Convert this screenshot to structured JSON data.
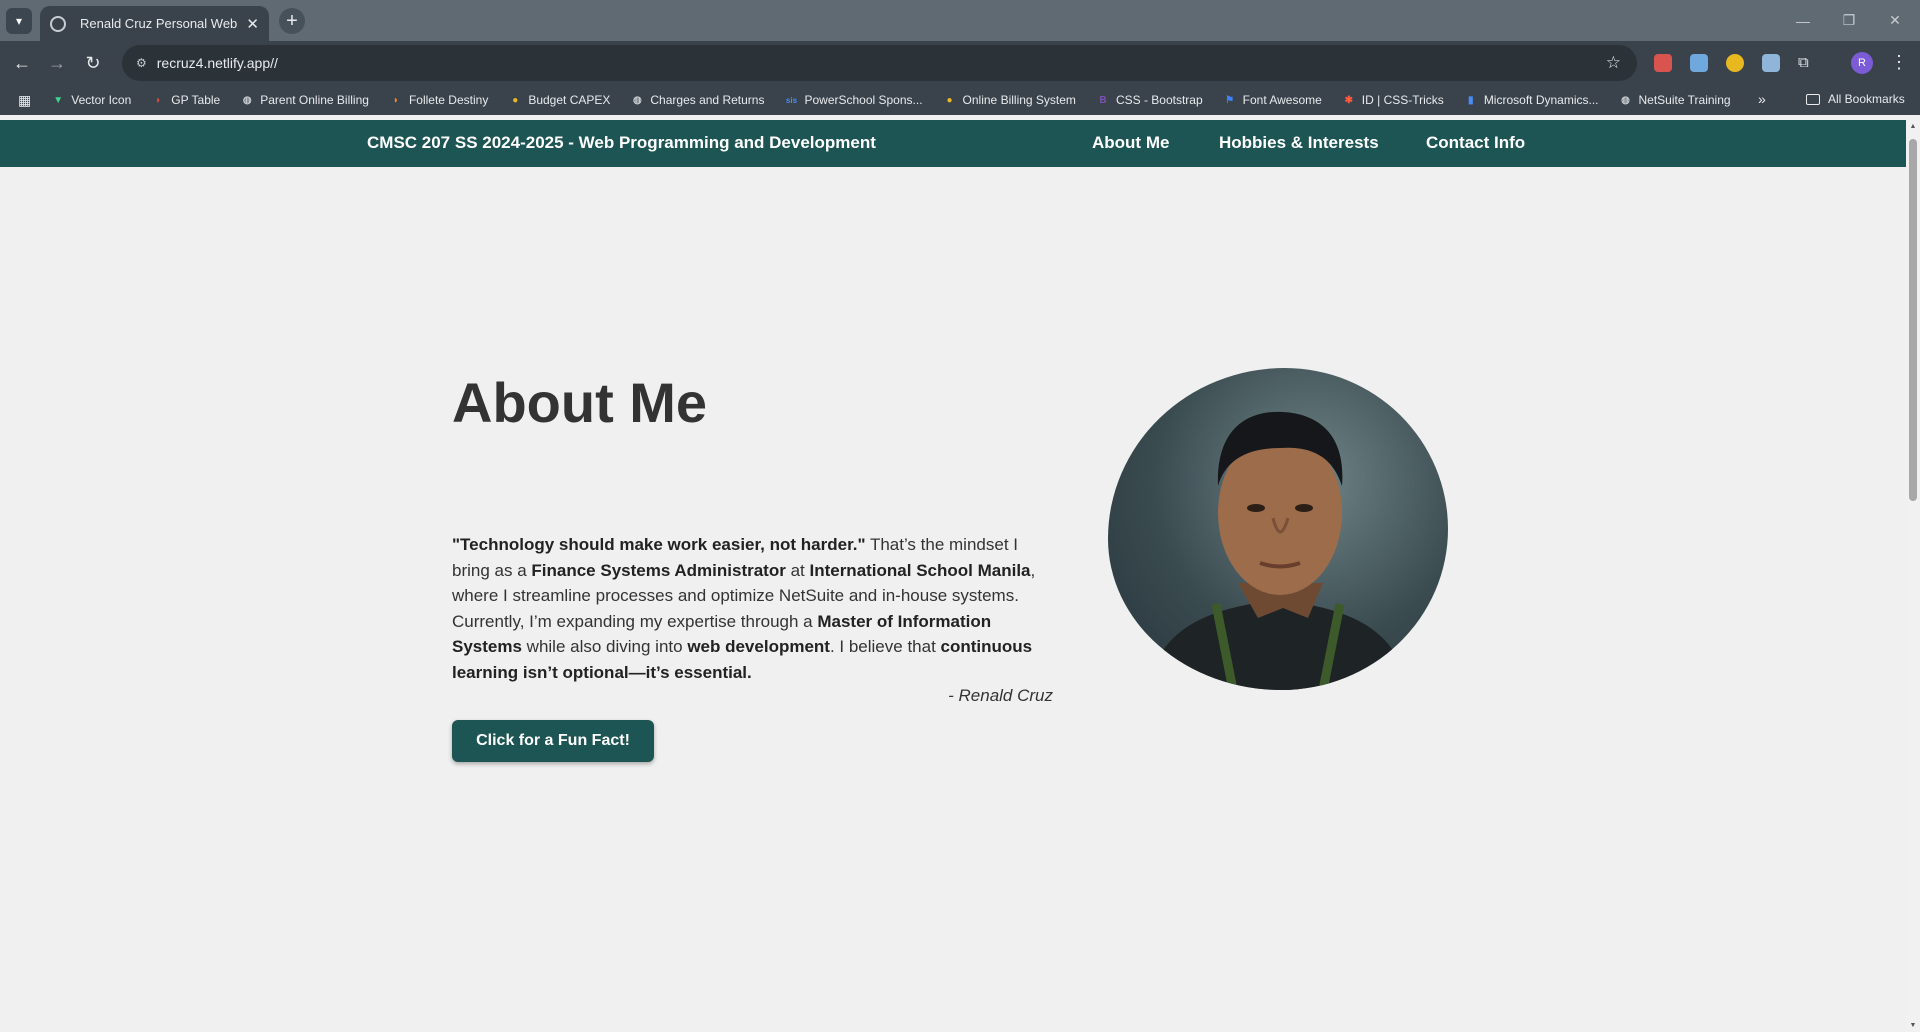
{
  "browser": {
    "tab_title": "Renald Cruz Personal Web Profile",
    "url": "recruz4.netlify.app//",
    "profile_initial": "R",
    "bookmarks": [
      {
        "label": "Vector Icon",
        "icon": "vector-icon",
        "color": "#3dd68c"
      },
      {
        "label": "GP Table",
        "icon": "gp-table-icon",
        "color": "#e84b3c"
      },
      {
        "label": "Parent Online Billing",
        "icon": "globe-icon",
        "color": "#c8cdd2"
      },
      {
        "label": "Follete Destiny",
        "icon": "destiny-icon",
        "color": "#f28c28"
      },
      {
        "label": "Budget CAPEX",
        "icon": "coin-icon",
        "color": "#e8b820"
      },
      {
        "label": "Charges and Returns",
        "icon": "globe-icon",
        "color": "#c8cdd2"
      },
      {
        "label": "PowerSchool Spons...",
        "icon": "sis-icon",
        "color": "#4a8bf5"
      },
      {
        "label": "Online Billing System",
        "icon": "coin-icon",
        "color": "#e8b820"
      },
      {
        "label": "CSS - Bootstrap",
        "icon": "bootstrap-icon",
        "color": "#7952b3"
      },
      {
        "label": "Font Awesome",
        "icon": "flag-icon",
        "color": "#3b82f6"
      },
      {
        "label": "ID | CSS-Tricks",
        "icon": "asterisk-icon",
        "color": "#ff5a3c"
      },
      {
        "label": "Microsoft Dynamics...",
        "icon": "chart-icon",
        "color": "#4a8bf5"
      },
      {
        "label": "NetSuite Training",
        "icon": "globe-icon",
        "color": "#c8cdd2"
      }
    ],
    "all_bookmarks": "All Bookmarks"
  },
  "site": {
    "title": "CMSC 207 SS 2024-2025 - Web Programming and Development",
    "nav": [
      "About Me",
      "Hobbies & Interests",
      "Contact Info"
    ],
    "heading": "About Me",
    "quote": "\"Technology should make work easier, not harder.\"",
    "t1": " That’s the mindset I bring as a ",
    "b1": "Finance Systems Administrator",
    "t2": " at ",
    "b2": "International School Manila",
    "t3": ", where I streamline processes and optimize NetSuite and in-house systems. Currently, I’m expanding my expertise through a ",
    "b3": "Master of Information Systems",
    "t4": " while also diving into ",
    "b4": "web development",
    "t5": ". I believe that ",
    "b5": "continuous learning isn’t optional—it’s essential.",
    "signature": "- Renald Cruz",
    "button_label": "Click for a Fun Fact!"
  },
  "colors": {
    "nav_bg": "#1c5553",
    "page_bg": "#f0f0f0"
  }
}
